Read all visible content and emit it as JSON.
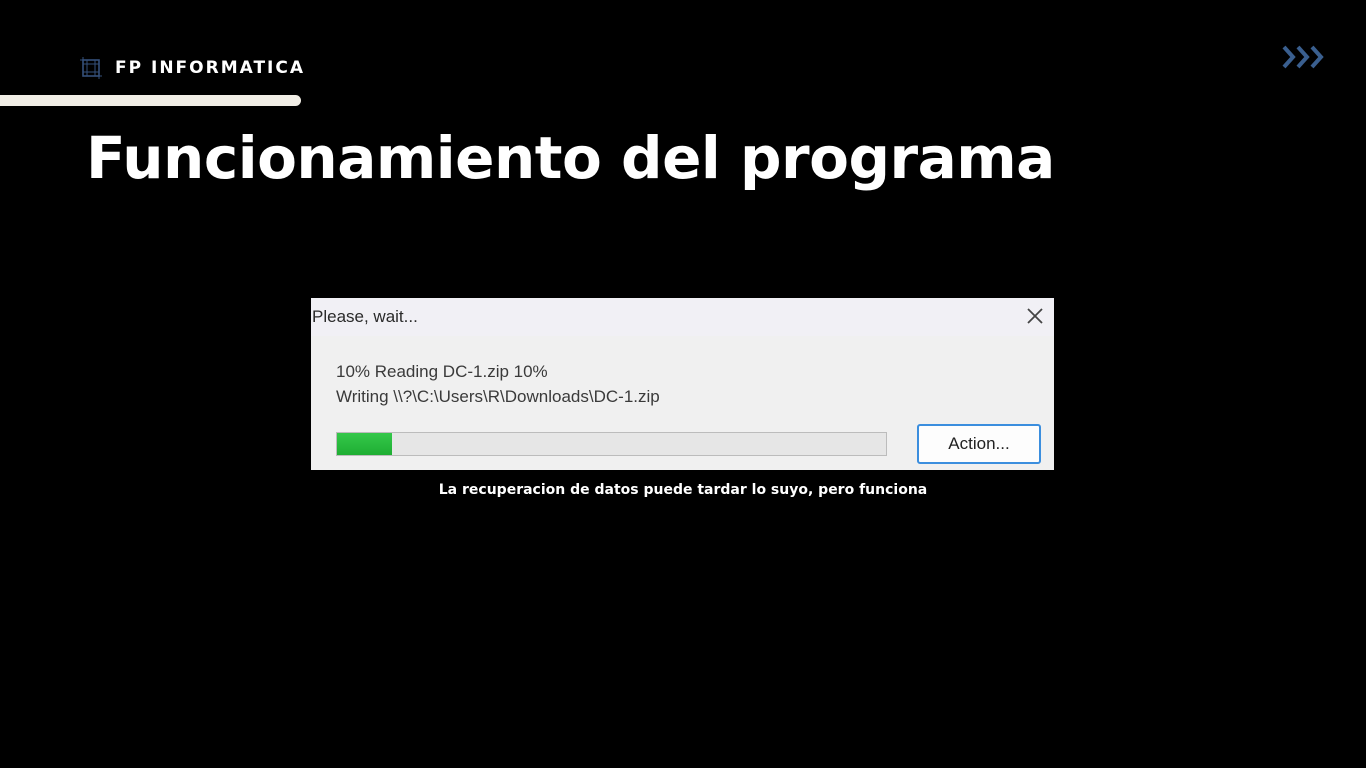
{
  "header": {
    "brand_name": "FP INFORMATICA",
    "brand_icon": "grid-frame-icon",
    "nav_icon": "triple-chevron-right-icon"
  },
  "slide": {
    "title": "Funcionamiento del programa",
    "caption": "La recuperacion de datos puede tardar lo suyo, pero funciona"
  },
  "dialog": {
    "title": "Please, wait...",
    "status_line": "10% Reading DC-1.zip 10%",
    "writing_line": "Writing \\\\?\\C:\\Users\\R\\Downloads\\DC-1.zip",
    "progress_percent": 10,
    "action_label": "Action...",
    "close_icon": "close-icon"
  },
  "colors": {
    "background": "#000000",
    "text": "#ffffff",
    "accent_bar": "#f1eee6",
    "chevrons": "#3a5f8f",
    "progress_fill": "#2bbd40",
    "button_border": "#3b8ede"
  }
}
